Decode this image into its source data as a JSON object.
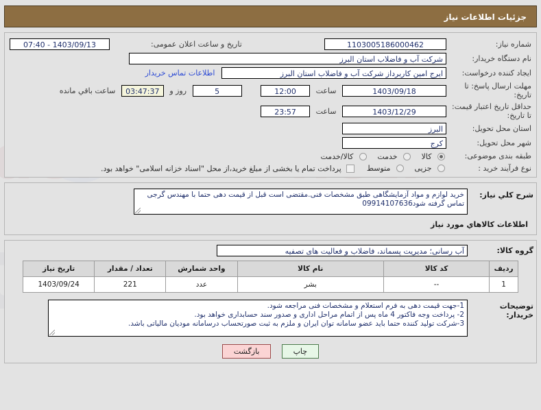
{
  "header": {
    "title": "جزئیات اطلاعات نیاز"
  },
  "form": {
    "need_number_label": "شماره نیاز:",
    "need_number_value": "1103005186000462",
    "public_announce_label": "تاریخ و ساعت اعلان عمومی:",
    "public_announce_value": "1403/09/13 - 07:40",
    "buyer_org_label": "نام دستگاه خریدار:",
    "buyer_org_value": "شرکت آب و فاضلاب استان البرز",
    "requester_label": "ایجاد کننده درخواست:",
    "requester_value": "ایرج امین کاربرداز شرکت آب و فاضلاب استان البرز",
    "contact_link": "اطلاعات تماس خریدار",
    "reply_deadline_label": "مهلت ارسال پاسخ: تا تاریخ:",
    "reply_deadline_date": "1403/09/18",
    "hour_label": "ساعت",
    "reply_deadline_time": "12:00",
    "remain_days": "5",
    "remain_days_label": "روز و",
    "remain_time": "03:47:37",
    "remain_suffix": "ساعت باقي مانده",
    "price_validity_label": "حداقل تاریخ اعتبار قیمت: تا تاریخ:",
    "price_validity_date": "1403/12/29",
    "price_validity_time": "23:57",
    "province_label": "استان محل تحویل:",
    "province_value": "البرز",
    "city_label": "شهر محل تحویل:",
    "city_value": "کرج",
    "category_label": "طبقه بندی موضوعی:",
    "category_options": [
      {
        "label": "کالا",
        "selected": true
      },
      {
        "label": "خدمت",
        "selected": false
      },
      {
        "label": "کالا/خدمت",
        "selected": false
      }
    ],
    "process_label": "نوع فرآیند خرید :",
    "process_options": [
      {
        "label": "جزیی",
        "selected": false
      },
      {
        "label": "متوسط",
        "selected": false
      }
    ],
    "treasury_checkbox_text": "پرداخت تمام یا بخشی از مبلغ خرید،از محل \"اسناد خزانه اسلامی\" خواهد بود.",
    "treasury_checked": false
  },
  "description": {
    "label": "شرح كلي نیاز:",
    "value": "خرید لوازم و مواد آزمایشگاهی طبق مشخصات فنی.مقتضی است قبل از قیمت دهی حتما با مهندس گرجی تماس گرفته شود09914107636"
  },
  "goods": {
    "section_title": "اطلاعات كالاهاي مورد نیاز",
    "group_label": "گروه كالا:",
    "group_value": "آب رسانی؛ مدیریت پسماند، فاضلاب و فعالیت های تصفیه",
    "columns": [
      "ردیف",
      "کد کالا",
      "نام کالا",
      "واحد شمارش",
      "تعداد / مقدار",
      "تاریخ نیاز"
    ],
    "rows": [
      {
        "row": "1",
        "code": "--",
        "name": "بشر",
        "unit": "عدد",
        "qty": "221",
        "date": "1403/09/24"
      }
    ]
  },
  "notes": {
    "label": "توضیحات خریدار:",
    "lines": [
      "1-جهت قیمت دهی به فرم استعلام و مشخصات فنی مراجعه شود.",
      "2- پرداخت وجه فاکتور 4 ماه پس از اتمام مراحل اداری و صدور سند حسابداری خواهد بود.",
      "3-شرکت تولید کننده حتما باید عضو سامانه توان ایران و ملزم به ثبت صورتحساب درسامانه مودیان مالیاتی باشد."
    ]
  },
  "buttons": {
    "print": "چاپ",
    "back": "بازگشت"
  },
  "colors": {
    "header_bg": "#8d6e42",
    "page_bg": "#e3e3e3",
    "value_text": "#1f2f6b",
    "link": "#2b49d4",
    "highlight_bg": "#f5f5dc",
    "print_btn": "#e7f7e7",
    "back_btn": "#fbd4d4"
  },
  "watermark": {
    "text": "iriatender.net"
  }
}
